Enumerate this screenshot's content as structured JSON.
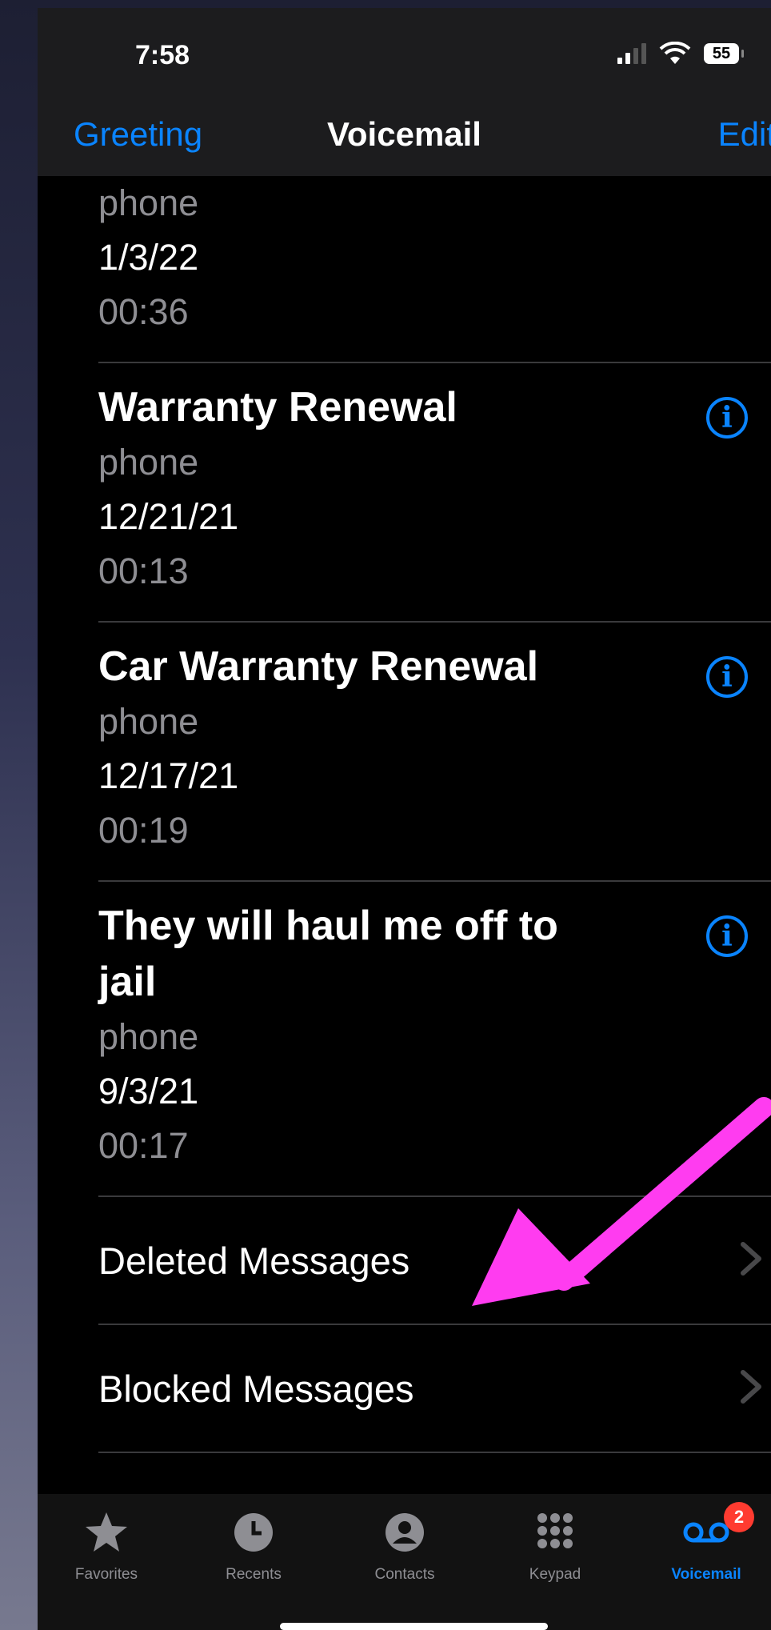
{
  "status_bar": {
    "time": "7:58",
    "battery": "55"
  },
  "nav": {
    "left_label": "Greeting",
    "title": "Voicemail",
    "right_label": "Edit"
  },
  "voicemails": [
    {
      "subtitle": "phone",
      "date": "1/3/22",
      "duration": "00:36"
    },
    {
      "title": "Warranty  Renewal",
      "subtitle": "phone",
      "date": "12/21/21",
      "duration": "00:13"
    },
    {
      "title": "Car Warranty  Renewal",
      "subtitle": "phone",
      "date": "12/17/21",
      "duration": "00:19"
    },
    {
      "title": "They will haul me off to jail",
      "subtitle": "phone",
      "date": "9/3/21",
      "duration": "00:17"
    }
  ],
  "rows": {
    "deleted": "Deleted Messages",
    "blocked": "Blocked Messages"
  },
  "tabs": [
    {
      "label": "Favorites",
      "icon": "star-icon"
    },
    {
      "label": "Recents",
      "icon": "clock-icon"
    },
    {
      "label": "Contacts",
      "icon": "person-circle-icon"
    },
    {
      "label": "Keypad",
      "icon": "keypad-icon"
    },
    {
      "label": "Voicemail",
      "icon": "voicemail-icon",
      "badge": "2",
      "active": true
    }
  ],
  "colors": {
    "accent": "#0a84ff",
    "annotation_arrow": "#ff3cf0",
    "badge": "#ff3b30"
  }
}
